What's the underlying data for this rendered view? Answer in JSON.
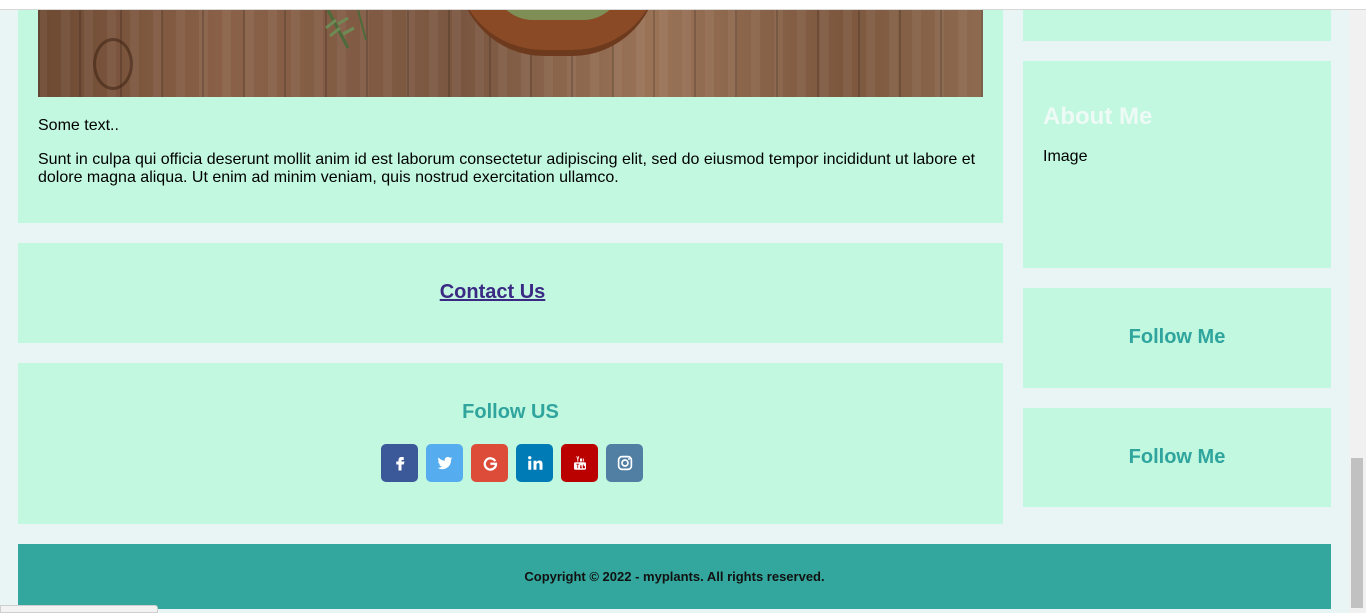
{
  "post": {
    "caption": "Some text..",
    "body": "Sunt in culpa qui officia deserunt mollit anim id est laborum consectetur adipiscing elit, sed do eiusmod tempor incididunt ut labore et dolore magna aliqua. Ut enim ad minim veniam, quis nostrud exercitation ullamco."
  },
  "contact": {
    "label": "Contact Us"
  },
  "follow_us": {
    "title": "Follow US",
    "social": [
      {
        "name": "facebook-icon",
        "color": "#3b5998"
      },
      {
        "name": "twitter-icon",
        "color": "#55acee"
      },
      {
        "name": "google-icon",
        "color": "#dd4b39"
      },
      {
        "name": "linkedin-icon",
        "color": "#007bb5"
      },
      {
        "name": "youtube-icon",
        "color": "#bb0000"
      },
      {
        "name": "instagram-icon",
        "color": "#517fa4"
      }
    ]
  },
  "sidebar": {
    "about_title": "About Me",
    "about_text": "Image",
    "follow_me_1": "Follow Me",
    "follow_me_2": "Follow Me"
  },
  "footer": {
    "copyright": "Copyright © 2022 - myplants. All rights reserved."
  },
  "colors": {
    "card": "#c2f7e0",
    "accent": "#2fa59d",
    "footer": "#33a79d",
    "page": "#e9f5f4"
  }
}
